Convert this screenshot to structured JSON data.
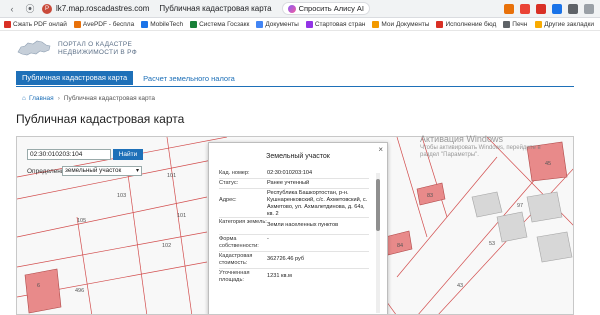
{
  "browser": {
    "url": "lk7.map.roscadastres.com",
    "tab_title": "Публичная кадастровая карта",
    "alice_label": "Спросить Алису AI"
  },
  "bookmarks": [
    {
      "label": "Сжать PDF онлай",
      "color": "#d93025"
    },
    {
      "label": "AvePDF - беспла",
      "color": "#e8710a"
    },
    {
      "label": "MobileTech",
      "color": "#1a73e8"
    },
    {
      "label": "Система Госзакк",
      "color": "#188038"
    },
    {
      "label": "Документы",
      "color": "#4285f4"
    },
    {
      "label": "Стартовая стран",
      "color": "#9334e6"
    },
    {
      "label": "Мои Документы",
      "color": "#f29900"
    },
    {
      "label": "Исполнение бюд",
      "color": "#d93025"
    },
    {
      "label": "Печн",
      "color": "#5f6368"
    }
  ],
  "bookmarks_other": "Другие закладки",
  "site": {
    "logo_line1": "ПОРТАЛ О КАДАСТРЕ",
    "logo_line2": "НЕДВИЖИМОСТИ В РФ",
    "tab_active": "Публичная кадастровая карта",
    "tab_link": "Расчет земельного налога",
    "breadcrumb_home": "Главная",
    "breadcrumb_current": "Публичная кадастровая карта",
    "page_title": "Публичная кадастровая карта"
  },
  "map": {
    "search_value": "02:30:010203:104",
    "search_button": "Найти",
    "define_label": "Определение:",
    "define_value": "земельный участок",
    "parcel_numbers": [
      "101",
      "102",
      "105",
      "103",
      "101",
      "6",
      "496",
      "84",
      "83",
      "53",
      "170",
      "97",
      "45",
      "43"
    ]
  },
  "popup": {
    "title": "Земельный участок",
    "close": "×",
    "rows": [
      {
        "k": "Кад. номер:",
        "v": "02:30:010203:104"
      },
      {
        "k": "Статус:",
        "v": "Ранее учтенный"
      },
      {
        "k": "Адрес:",
        "v": "Республика Башкортостан, р-н. Кушнаренковский, с/с. Ахметовский, с. Ахметово, ул. Ахмалетдинова, д. 64з, кв. 2"
      },
      {
        "k": "Категория земель:",
        "v": "Земли населенных пунктов"
      },
      {
        "k": "Форма собственности:",
        "v": "-"
      },
      {
        "k": "Кадастровая стоимость:",
        "v": "362726.46 руб"
      },
      {
        "k": "Уточненная площадь:",
        "v": "1231 кв.м"
      }
    ]
  },
  "watermark": {
    "title": "Активация Windows",
    "sub1": "Чтобы активировать Windows, перейдите в",
    "sub2": "раздел \"Параметры\"."
  }
}
